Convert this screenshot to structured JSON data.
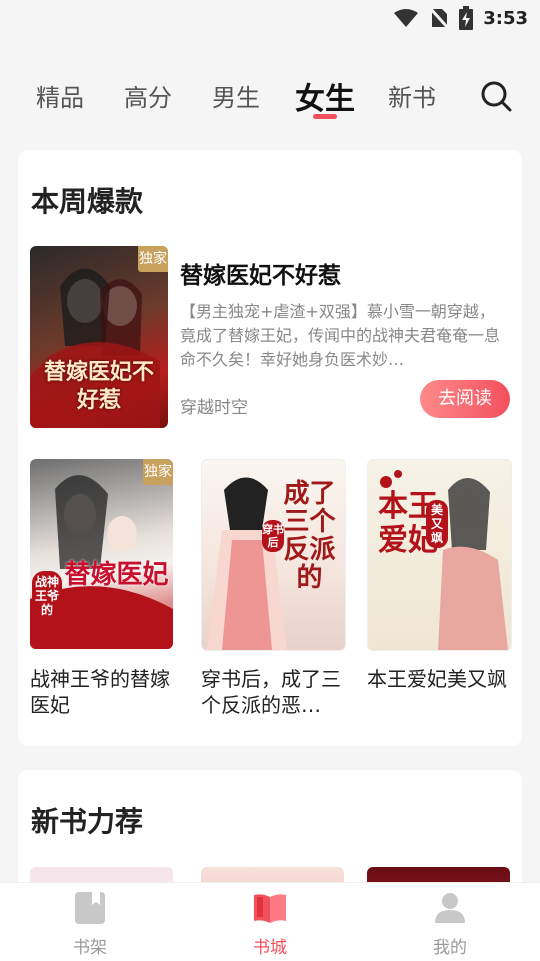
{
  "status": {
    "time": "3:53",
    "icons": [
      "wifi-icon",
      "no-sim-icon",
      "battery-charging-icon"
    ]
  },
  "tabs": [
    {
      "label": "精品",
      "active": false
    },
    {
      "label": "高分",
      "active": false
    },
    {
      "label": "男生",
      "active": false
    },
    {
      "label": "女生",
      "active": true
    },
    {
      "label": "新书",
      "active": false
    }
  ],
  "search_icon": "search-icon",
  "colors": {
    "accent": "#f2505d",
    "badge": "#c8a15c",
    "background": "#f5f5f5"
  },
  "weekly": {
    "title": "本周爆款",
    "featured": {
      "badge": "独家",
      "cover_title": "替嫁医妃不好惹",
      "title": "替嫁医妃不好惹",
      "description": "【男主独宠+虐渣+双强】慕小雪一朝穿越，竟成了替嫁王妃，传闻中的战神夫君奄奄一息命不久矣！幸好她身负医术妙…",
      "genre": "穿越时空",
      "read_button": "去阅读"
    },
    "books": [
      {
        "name": "战神王爷的替嫁医妃",
        "badge": "独家",
        "cover_title": "替嫁医妃",
        "cover_sub": "战神王爷的"
      },
      {
        "name": "穿书后，成了三个反派的恶…",
        "cover_title": "成了三个反派的",
        "cover_sub": "穿书后"
      },
      {
        "name": "本王爱妃美又飒",
        "cover_title": "本王爱妃",
        "cover_sub": "美又飒"
      }
    ]
  },
  "new_books": {
    "title": "新书力荐"
  },
  "bottom_nav": [
    {
      "label": "书架",
      "icon": "bookshelf-icon",
      "active": false
    },
    {
      "label": "书城",
      "icon": "bookstore-icon",
      "active": true
    },
    {
      "label": "我的",
      "icon": "profile-icon",
      "active": false
    }
  ]
}
